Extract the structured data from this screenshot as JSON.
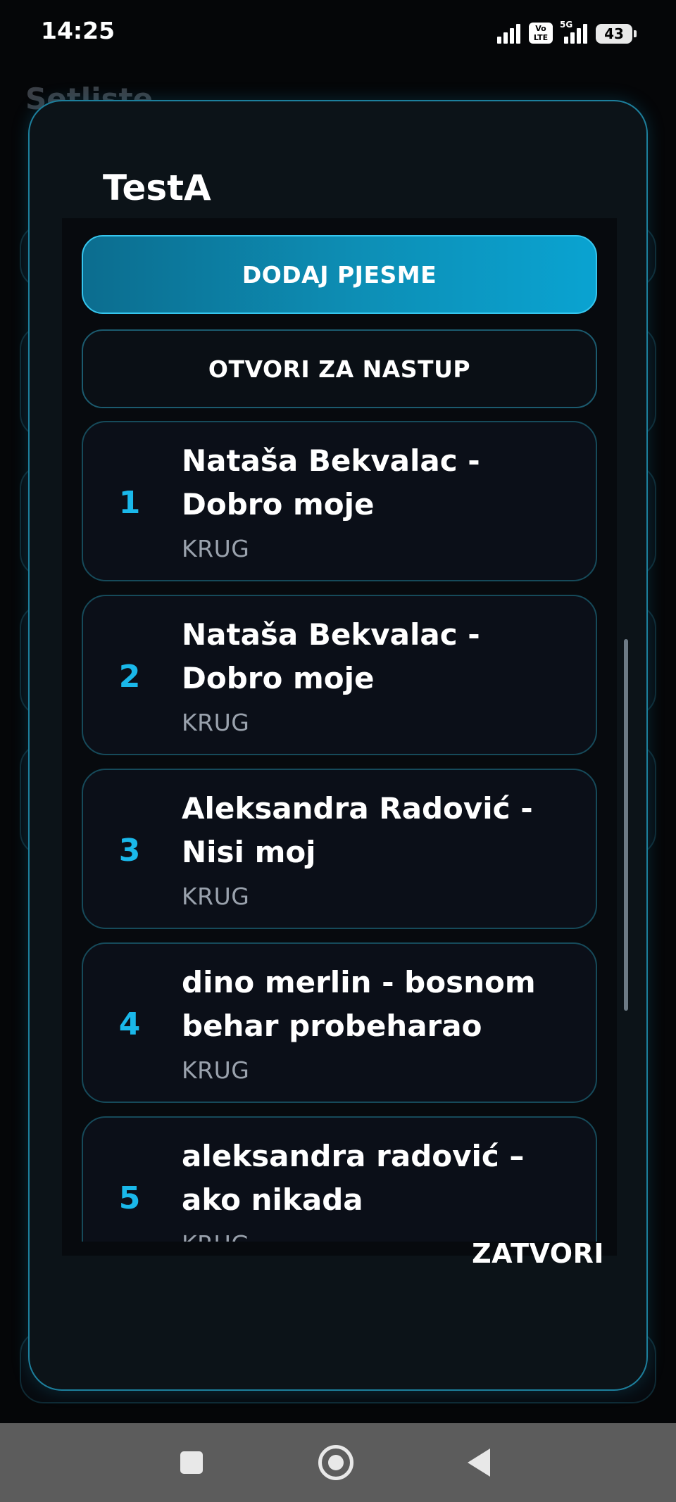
{
  "status_bar": {
    "time": "14:25",
    "volte_label": "Vo\nLTE",
    "network_label": "5G",
    "battery": "43"
  },
  "background_page": {
    "title": "Setliste"
  },
  "dialog": {
    "title": "TestA",
    "add_songs_label": "DODAJ PJESME",
    "open_for_performance_label": "OTVORI ZA NASTUP",
    "close_label": "ZATVORI",
    "songs": [
      {
        "number": "1",
        "title": "Nataša Bekvalac - Dobro moje",
        "subtitle": "KRUG"
      },
      {
        "number": "2",
        "title": "Nataša Bekvalac - Dobro moje",
        "subtitle": "KRUG"
      },
      {
        "number": "3",
        "title": "Aleksandra Radović - Nisi moj",
        "subtitle": "KRUG"
      },
      {
        "number": "4",
        "title": "dino merlin - bosnom behar probeharao",
        "subtitle": "KRUG"
      },
      {
        "number": "5",
        "title": "aleksandra radović – ako nikada",
        "subtitle": "KRUG"
      }
    ]
  },
  "colors": {
    "accent": "#1ab8ea",
    "dialog_border": "#1d7f9c",
    "primary_button": "#0d8fb6"
  },
  "icons": {
    "nav_recents": "square-icon",
    "nav_home": "circle-icon",
    "nav_back": "triangle-back-icon"
  }
}
